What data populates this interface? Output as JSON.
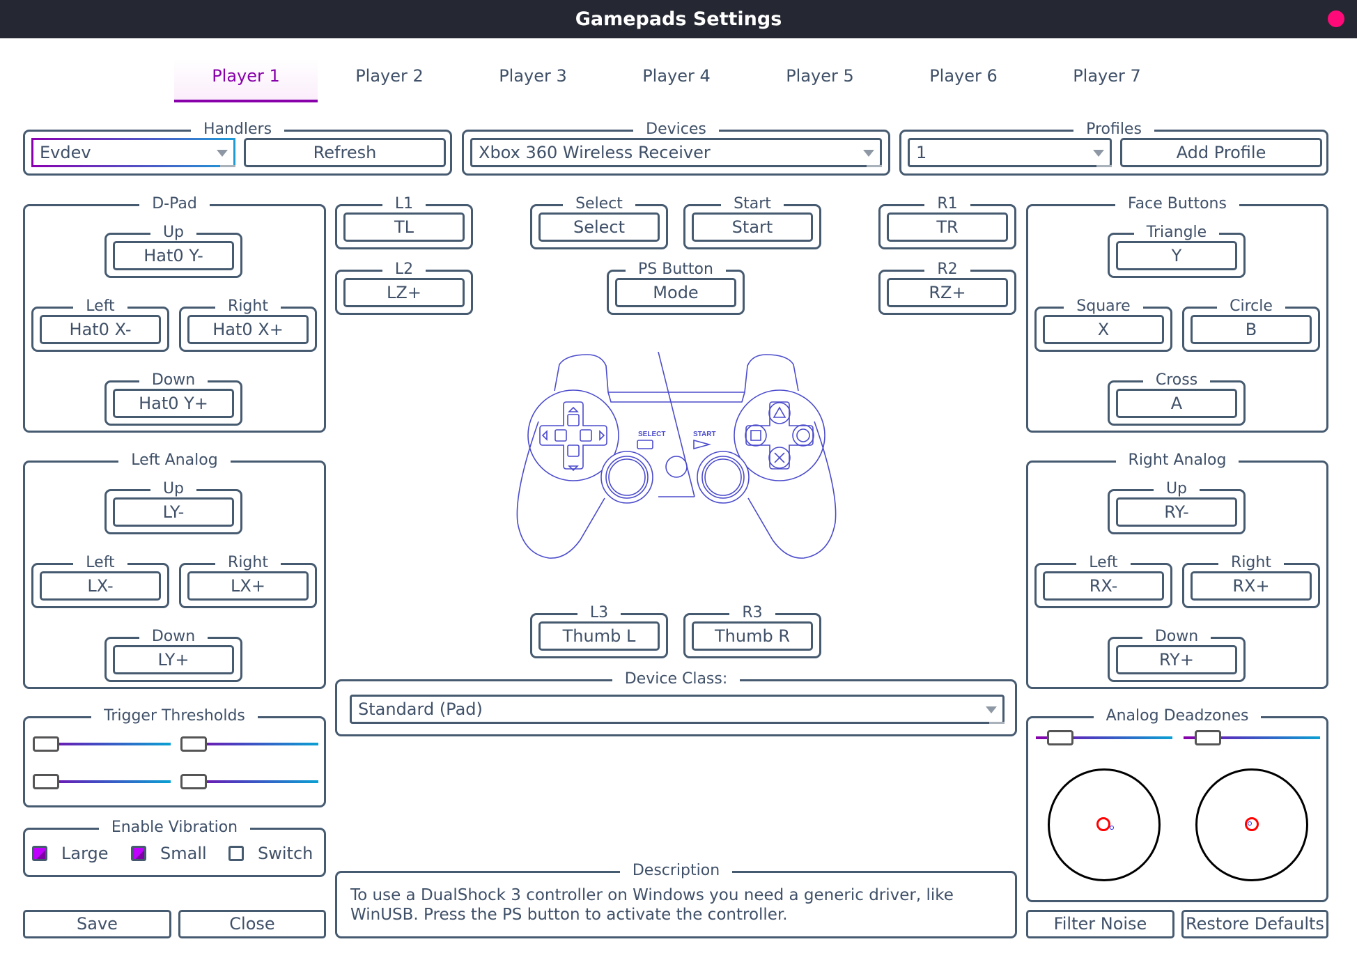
{
  "window": {
    "title": "Gamepads Settings",
    "close_color": "#ff0a78"
  },
  "tabs": [
    {
      "label": "Player 1",
      "active": true
    },
    {
      "label": "Player 2",
      "active": false
    },
    {
      "label": "Player 3",
      "active": false
    },
    {
      "label": "Player 4",
      "active": false
    },
    {
      "label": "Player 5",
      "active": false
    },
    {
      "label": "Player 6",
      "active": false
    },
    {
      "label": "Player 7",
      "active": false
    }
  ],
  "handlers": {
    "legend": "Handlers",
    "selected": "Evdev",
    "refresh_label": "Refresh"
  },
  "devices": {
    "legend": "Devices",
    "selected": "Xbox 360 Wireless Receiver"
  },
  "profiles": {
    "legend": "Profiles",
    "selected": "1",
    "add_label": "Add Profile"
  },
  "dpad": {
    "legend": "D-Pad",
    "up": {
      "label": "Up",
      "value": "Hat0 Y-"
    },
    "left": {
      "label": "Left",
      "value": "Hat0 X-"
    },
    "right": {
      "label": "Right",
      "value": "Hat0 X+"
    },
    "down": {
      "label": "Down",
      "value": "Hat0 Y+"
    }
  },
  "left_analog": {
    "legend": "Left Analog",
    "up": {
      "label": "Up",
      "value": "LY-"
    },
    "left": {
      "label": "Left",
      "value": "LX-"
    },
    "right": {
      "label": "Right",
      "value": "LX+"
    },
    "down": {
      "label": "Down",
      "value": "LY+"
    }
  },
  "face": {
    "legend": "Face Buttons",
    "triangle": {
      "label": "Triangle",
      "value": "Y"
    },
    "square": {
      "label": "Square",
      "value": "X"
    },
    "circle": {
      "label": "Circle",
      "value": "B"
    },
    "cross": {
      "label": "Cross",
      "value": "A"
    }
  },
  "right_analog": {
    "legend": "Right Analog",
    "up": {
      "label": "Up",
      "value": "RY-"
    },
    "left": {
      "label": "Left",
      "value": "RX-"
    },
    "right": {
      "label": "Right",
      "value": "RX+"
    },
    "down": {
      "label": "Down",
      "value": "RY+"
    }
  },
  "center": {
    "l1": {
      "label": "L1",
      "value": "TL"
    },
    "l2": {
      "label": "L2",
      "value": "LZ+"
    },
    "select": {
      "label": "Select",
      "value": "Select"
    },
    "start": {
      "label": "Start",
      "value": "Start"
    },
    "ps": {
      "label": "PS Button",
      "value": "Mode"
    },
    "r1": {
      "label": "R1",
      "value": "TR"
    },
    "r2": {
      "label": "R2",
      "value": "RZ+"
    },
    "l3": {
      "label": "L3",
      "value": "Thumb L"
    },
    "r3": {
      "label": "R3",
      "value": "Thumb R"
    },
    "controller_labels": {
      "select": "SELECT",
      "start": "START"
    }
  },
  "device_class": {
    "legend": "Device Class:",
    "selected": "Standard (Pad)"
  },
  "description": {
    "legend": "Description",
    "text": "To use a DualShock 3 controller on Windows you need a generic driver, like WinUSB. Press the PS button to activate the controller."
  },
  "trigger_thresholds": {
    "legend": "Trigger Thresholds",
    "values": [
      0,
      0,
      0,
      0
    ]
  },
  "vibration": {
    "legend": "Enable Vibration",
    "options": [
      {
        "label": "Large",
        "checked": true
      },
      {
        "label": "Small",
        "checked": true
      },
      {
        "label": "Switch",
        "checked": false
      }
    ]
  },
  "deadzones": {
    "legend": "Analog Deadzones",
    "values": [
      0.1,
      0.1
    ]
  },
  "buttons": {
    "save": "Save",
    "close": "Close",
    "filter_noise": "Filter Noise",
    "restore_defaults": "Restore Defaults"
  },
  "colors": {
    "accent": "#8800aa",
    "text": "#3f5068",
    "border": "#465a70",
    "controller_line": "#4b4bcc"
  }
}
